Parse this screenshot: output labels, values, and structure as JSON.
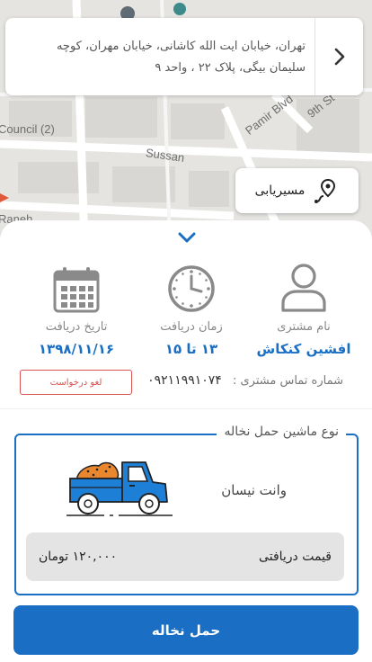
{
  "map": {
    "labels": [
      "Pamir Blvd",
      "9th St",
      "Sussan",
      "Council (2)",
      "Raneh"
    ]
  },
  "address": {
    "text": "تهران، خیابان ایت الله کاشانی، خیابان مهران، کوچه سلیمان بیگی، پلاک ۲۲ ، واحد ۹"
  },
  "route_button": {
    "label": "مسیریابی"
  },
  "info": {
    "customer_label": "نام مشتری",
    "customer_value": "افشین کنکاش",
    "time_label": "زمان دریافت",
    "time_value": "۱۳ تا ۱۵",
    "date_label": "تاریخ دریافت",
    "date_value": "۱۳۹۸/۱۱/۱۶"
  },
  "phone": {
    "label": "شماره تماس مشتری :",
    "value": "۰۹۲۱۱۹۹۱۰۷۴"
  },
  "cancel_button": {
    "label": "لغو درخواست"
  },
  "vehicle": {
    "legend": "نوع ماشین حمل نخاله",
    "name": "وانت نیسان",
    "price_label": "قیمت دریافتی",
    "price_value": "۱۲۰,۰۰۰ تومان"
  },
  "submit_button": {
    "label": "حمل نخاله"
  },
  "colors": {
    "accent": "#1a6fc4",
    "danger": "#d9534f"
  }
}
